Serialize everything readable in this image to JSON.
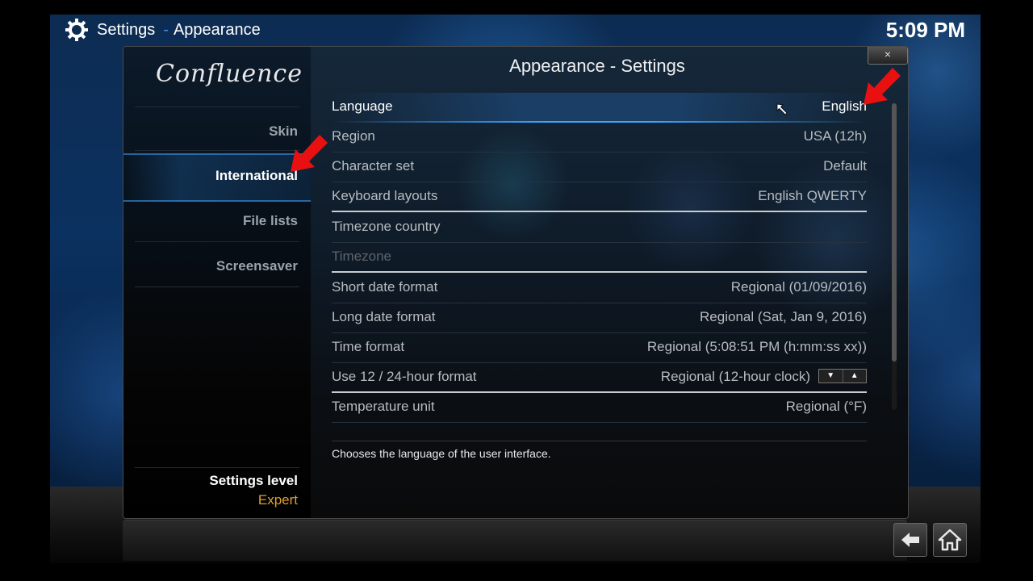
{
  "header": {
    "section": "Settings",
    "subsection": "Appearance"
  },
  "clock": "5:09 PM",
  "sidebar": {
    "logo": "Confluence",
    "items": [
      {
        "label": "Skin",
        "active": false
      },
      {
        "label": "International",
        "active": true
      },
      {
        "label": "File lists",
        "active": false
      },
      {
        "label": "Screensaver",
        "active": false
      }
    ],
    "settings_level_label": "Settings level",
    "settings_level_value": "Expert"
  },
  "dialog": {
    "title": "Appearance - Settings",
    "close_label": "×",
    "settings": [
      {
        "label": "Language",
        "value": "English"
      },
      {
        "label": "Region",
        "value": "USA (12h)"
      },
      {
        "label": "Character set",
        "value": "Default"
      },
      {
        "label": "Keyboard layouts",
        "value": "English QWERTY"
      },
      {
        "label": "Timezone country",
        "value": ""
      },
      {
        "label": "Timezone",
        "value": ""
      },
      {
        "label": "Short date format",
        "value": "Regional (01/09/2016)"
      },
      {
        "label": "Long date format",
        "value": "Regional (Sat, Jan 9, 2016)"
      },
      {
        "label": "Time format",
        "value": "Regional (5:08:51 PM (h:mm:ss xx))"
      },
      {
        "label": "Use 12 / 24-hour format",
        "value": "Regional (12-hour clock)"
      },
      {
        "label": "Temperature unit",
        "value": "Regional (°F)"
      }
    ],
    "description": "Chooses the language of the user interface."
  },
  "spinner": {
    "down": "▼",
    "up": "▲"
  },
  "colors": {
    "accent": "#3fa2ff",
    "settings_level": "#e0a030",
    "arrow": "#e81010"
  },
  "icons": [
    "gear-icon",
    "back-arrow-icon",
    "home-icon",
    "close-icon",
    "red-arrow-annotation",
    "mouse-cursor-icon"
  ]
}
